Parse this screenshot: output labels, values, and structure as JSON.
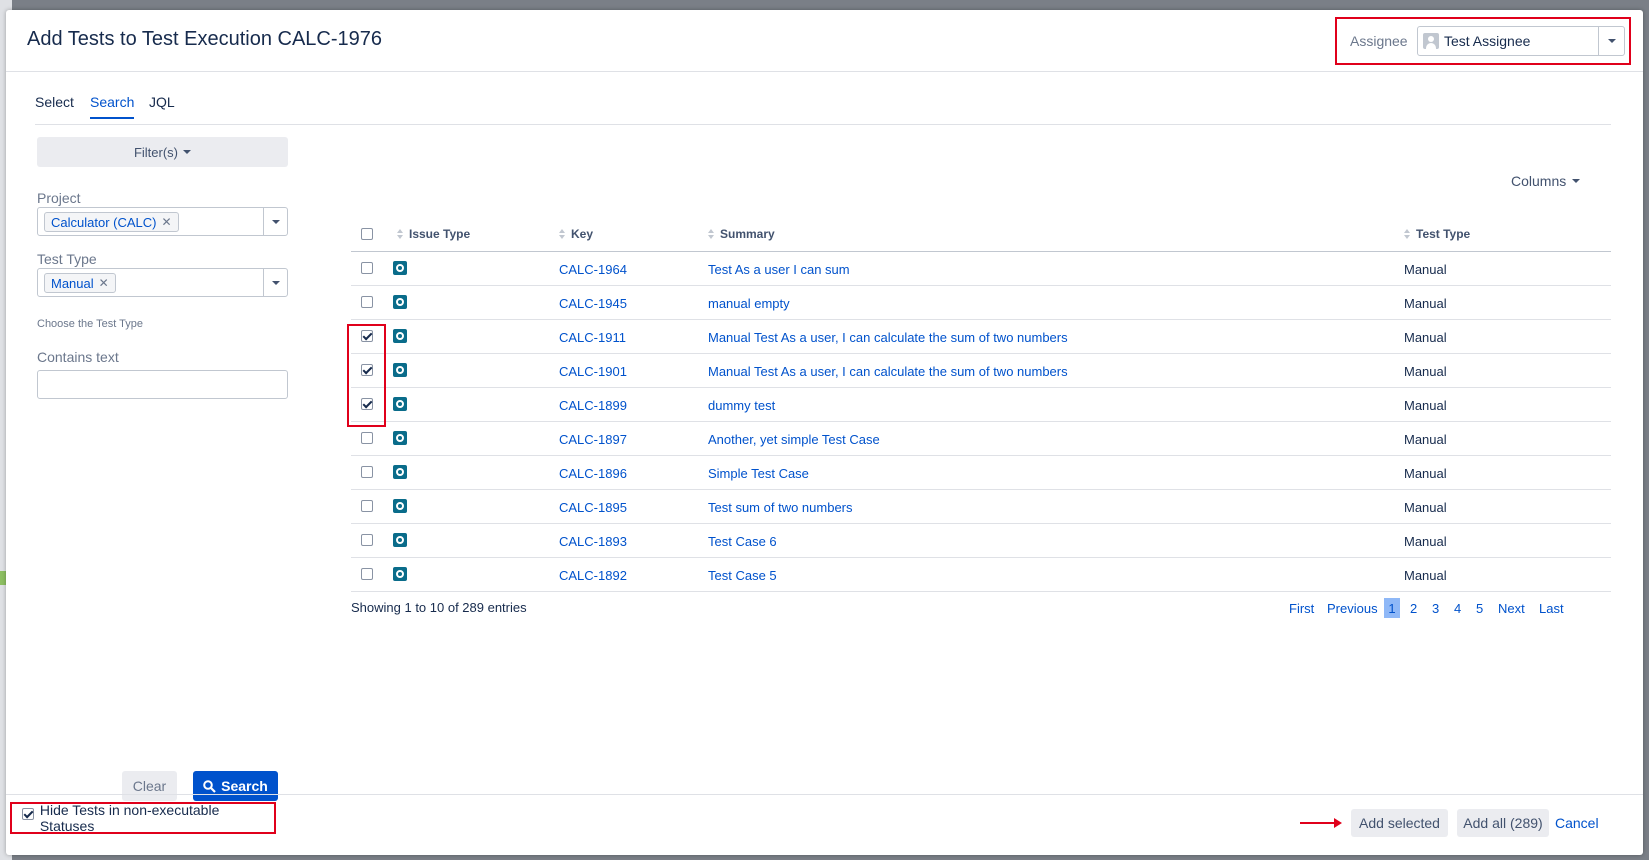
{
  "dialog": {
    "title": "Add Tests to Test Execution CALC-1976",
    "assignee": {
      "label": "Assignee",
      "value": "Test Assignee"
    }
  },
  "tabs": [
    {
      "label": "Select",
      "active": false
    },
    {
      "label": "Search",
      "active": true
    },
    {
      "label": "JQL",
      "active": false
    }
  ],
  "filters": {
    "toggle_label": "Filter(s)",
    "project": {
      "label": "Project",
      "value": "Calculator (CALC)"
    },
    "test_type": {
      "label": "Test Type",
      "value": "Manual",
      "help": "Choose the Test Type"
    },
    "contains_text": {
      "label": "Contains text",
      "value": ""
    },
    "clear_label": "Clear",
    "search_label": "Search"
  },
  "table": {
    "columns_label": "Columns",
    "headers": [
      "Issue Type",
      "Key",
      "Summary",
      "Test Type"
    ],
    "rows": [
      {
        "key": "CALC-1964",
        "summary": "Test As a user I can sum",
        "test_type": "Manual",
        "checked": false
      },
      {
        "key": "CALC-1945",
        "summary": "manual empty",
        "test_type": "Manual",
        "checked": false
      },
      {
        "key": "CALC-1911",
        "summary": "Manual Test As a user, I can calculate the sum of two numbers",
        "test_type": "Manual",
        "checked": true
      },
      {
        "key": "CALC-1901",
        "summary": "Manual Test As a user, I can calculate the sum of two numbers",
        "test_type": "Manual",
        "checked": true
      },
      {
        "key": "CALC-1899",
        "summary": "dummy test",
        "test_type": "Manual",
        "checked": true
      },
      {
        "key": "CALC-1897",
        "summary": "Another, yet simple Test Case",
        "test_type": "Manual",
        "checked": false
      },
      {
        "key": "CALC-1896",
        "summary": "Simple Test Case",
        "test_type": "Manual",
        "checked": false
      },
      {
        "key": "CALC-1895",
        "summary": "Test sum of two numbers",
        "test_type": "Manual",
        "checked": false
      },
      {
        "key": "CALC-1893",
        "summary": "Test Case 6",
        "test_type": "Manual",
        "checked": false
      },
      {
        "key": "CALC-1892",
        "summary": "Test Case 5",
        "test_type": "Manual",
        "checked": false
      }
    ],
    "issue_type_icon": "test-issue-icon",
    "showing": "Showing 1 to 10 of 289 entries"
  },
  "pagination": {
    "first": "First",
    "previous": "Previous",
    "pages": [
      "1",
      "2",
      "3",
      "4",
      "5"
    ],
    "current": "1",
    "next": "Next",
    "last": "Last"
  },
  "footer": {
    "hide_label": "Hide Tests in non-executable Statuses",
    "hide_checked": true,
    "add_selected": "Add selected",
    "add_all": "Add all (289)",
    "cancel": "Cancel"
  },
  "colors": {
    "primary": "#0052cc",
    "highlight": "#e0001b",
    "issue_type": "#0a6c8a"
  }
}
